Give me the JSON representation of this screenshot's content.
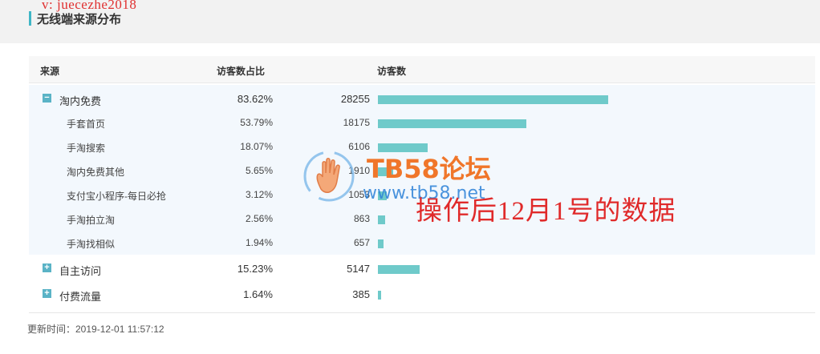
{
  "section": {
    "title": "无线端来源分布"
  },
  "watermarks": {
    "top_handle": "v: juecezhe2018",
    "brand": "TB58论坛",
    "url": "www.tb58.net",
    "note": "操作后12月1号的数据"
  },
  "table": {
    "headers": {
      "source": "来源",
      "ratio": "访客数占比",
      "visitors": "访客数"
    },
    "max_visitors": 28255,
    "rows": [
      {
        "name": "淘内免费",
        "ratio": "83.62%",
        "visitors": 28255,
        "visitors_text": "28255",
        "level": 0,
        "toggle": "−",
        "expanded": true
      },
      {
        "name": "手套首页",
        "ratio": "53.79%",
        "visitors": 18175,
        "visitors_text": "18175",
        "level": 1
      },
      {
        "name": "手淘搜索",
        "ratio": "18.07%",
        "visitors": 6106,
        "visitors_text": "6106",
        "level": 1
      },
      {
        "name": "淘内免费其他",
        "ratio": "5.65%",
        "visitors": 1910,
        "visitors_text": "1910",
        "level": 1
      },
      {
        "name": "支付宝小程序-每日必抢",
        "ratio": "3.12%",
        "visitors": 1053,
        "visitors_text": "1053",
        "level": 1
      },
      {
        "name": "手淘拍立淘",
        "ratio": "2.56%",
        "visitors": 863,
        "visitors_text": "863",
        "level": 1
      },
      {
        "name": "手淘找相似",
        "ratio": "1.94%",
        "visitors": 657,
        "visitors_text": "657",
        "level": 1
      },
      {
        "name": "自主访问",
        "ratio": "15.23%",
        "visitors": 5147,
        "visitors_text": "5147",
        "level": 0,
        "toggle": "+",
        "expanded": false
      },
      {
        "name": "付费流量",
        "ratio": "1.64%",
        "visitors": 385,
        "visitors_text": "385",
        "level": 0,
        "toggle": "+",
        "expanded": false
      }
    ]
  },
  "footer": {
    "update_time": "更新时间：2019-12-01 11:57:12"
  },
  "colors": {
    "bar": "#6fcaca",
    "toggle": "#5ab3c6",
    "accent": "#3fb6c6"
  }
}
